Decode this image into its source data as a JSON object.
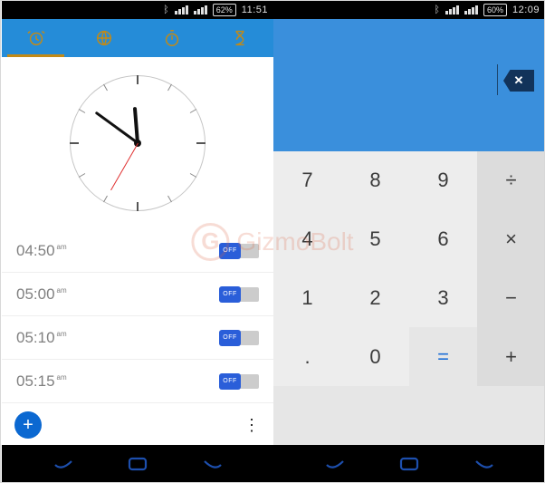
{
  "watermark": {
    "initial": "G",
    "text": "GizmoBolt"
  },
  "left": {
    "status": {
      "battery": "62%",
      "time": "11:51"
    },
    "tabs": [
      "alarm",
      "world-clock",
      "stopwatch",
      "timer"
    ],
    "active_tab": 0,
    "analog_clock": {
      "hour": 11,
      "minute": 51,
      "second": 35
    },
    "alarms": [
      {
        "time": "04:50",
        "ampm": "am",
        "state": "OFF"
      },
      {
        "time": "05:00",
        "ampm": "am",
        "state": "OFF"
      },
      {
        "time": "05:10",
        "ampm": "am",
        "state": "OFF"
      },
      {
        "time": "05:15",
        "ampm": "am",
        "state": "OFF"
      }
    ],
    "add_label": "+",
    "overflow_label": "⋮"
  },
  "right": {
    "status": {
      "battery": "60%",
      "time": "12:09"
    },
    "display_value": "",
    "delete_label": "✕",
    "keys": [
      {
        "label": "7",
        "kind": "num"
      },
      {
        "label": "8",
        "kind": "num"
      },
      {
        "label": "9",
        "kind": "num"
      },
      {
        "label": "÷",
        "kind": "op"
      },
      {
        "label": "4",
        "kind": "num"
      },
      {
        "label": "5",
        "kind": "num"
      },
      {
        "label": "6",
        "kind": "num"
      },
      {
        "label": "×",
        "kind": "op"
      },
      {
        "label": "1",
        "kind": "num"
      },
      {
        "label": "2",
        "kind": "num"
      },
      {
        "label": "3",
        "kind": "num"
      },
      {
        "label": "−",
        "kind": "op"
      },
      {
        "label": ".",
        "kind": "num"
      },
      {
        "label": "0",
        "kind": "num"
      },
      {
        "label": "=",
        "kind": "eq"
      },
      {
        "label": "+",
        "kind": "op"
      }
    ]
  },
  "nav": [
    "back",
    "home",
    "recent"
  ]
}
